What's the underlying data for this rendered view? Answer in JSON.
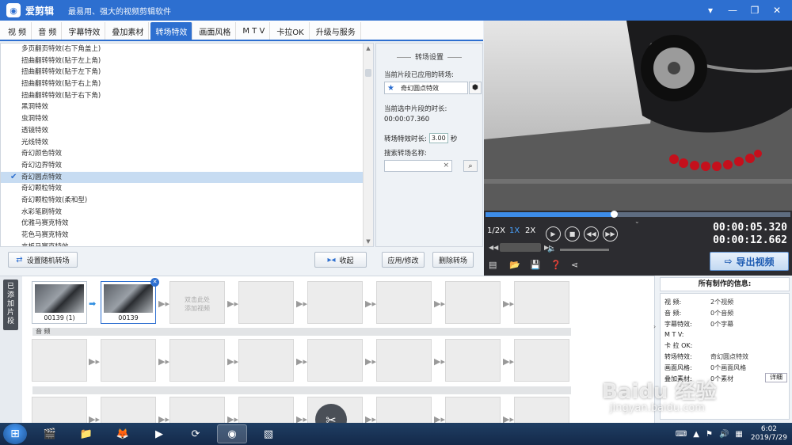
{
  "window": {
    "app_name": "爱剪辑",
    "slogan": "最易用、强大的视频剪辑软件",
    "logo_glyph": "◉",
    "controls": [
      "▾",
      "—",
      "❐",
      "✕"
    ]
  },
  "tabs": [
    {
      "label": "视 频",
      "active": false
    },
    {
      "label": "音 频",
      "active": false
    },
    {
      "label": "字幕特效",
      "active": false
    },
    {
      "label": "叠加素材",
      "active": false
    },
    {
      "label": "转场特效",
      "active": true
    },
    {
      "label": "画面风格",
      "active": false
    },
    {
      "label": "M T V",
      "active": false
    },
    {
      "label": "卡拉OK",
      "active": false
    },
    {
      "label": "升级与服务",
      "active": false
    }
  ],
  "effect_list": {
    "items": [
      "多页翻页特效(右下角盖上)",
      "扭曲翻转特效(贴于左上角)",
      "扭曲翻转特效(贴于左下角)",
      "扭曲翻转特效(贴于右上角)",
      "扭曲翻转特效(贴于右下角)",
      "黑洞特效",
      "虫洞特效",
      "透镜特效",
      "光线特效",
      "奇幻颜色特效",
      "奇幻边界特效",
      "奇幻圆点特效",
      "奇幻颗粒特效",
      "奇幻颗粒特效(柔和型)",
      "水彩笔刷特效",
      "优雅马赛克特效",
      "花色马赛克特效",
      "夹板马赛克特效"
    ],
    "selected_index": 11,
    "check_glyph": "✔",
    "scroll_up": "▲",
    "scroll_down": "▼"
  },
  "settings": {
    "title": "转场设置",
    "applied_label": "当前片段已应用的转场:",
    "applied_value": "奇幻圆点特效",
    "selected_duration_label": "当前选中片段的时长:",
    "selected_duration_value": "00:00:07.360",
    "transition_duration_label": "转场特效时长:",
    "transition_duration_value": "3.00",
    "seconds_unit": "秒",
    "search_label": "搜索转场名称:",
    "search_value": "",
    "search_clear": "×"
  },
  "actions": {
    "random_transition": "设置随机转场",
    "collapse": "收起",
    "apply_modify": "应用/修改",
    "delete_transition": "删除转场"
  },
  "player": {
    "speed_half": "1/2X",
    "speed_1x": "1X",
    "speed_2x": "2X",
    "current_time": "00:00:05.320",
    "total_time": "00:00:12.662",
    "progress_fraction": 0.42,
    "export_label": "导出视频"
  },
  "timeline": {
    "side_label": "已添加片段",
    "clips": [
      {
        "name": "00139 (1)",
        "selected": false
      },
      {
        "name": "00139",
        "selected": true
      }
    ],
    "add_hint": "双击此处\n添加视频",
    "audio_label": "音 频",
    "slot_count": 8
  },
  "info_panel": {
    "title": "所有制作的信息:",
    "rows": [
      {
        "k": "视    频:",
        "v": "2个视频"
      },
      {
        "k": "音    频:",
        "v": "0个音频"
      },
      {
        "k": "字幕特效:",
        "v": "0个字幕"
      },
      {
        "k": "M  T  V:",
        "v": ""
      },
      {
        "k": "卡 拉 OK:",
        "v": ""
      },
      {
        "k": "转场特效:",
        "v": "奇幻圆点特效"
      },
      {
        "k": "画面风格:",
        "v": "0个画面风格"
      },
      {
        "k": "叠加素材:",
        "v": "0个素材"
      }
    ],
    "detail_label": "详细"
  },
  "taskbar": {
    "apps": [
      "🎬",
      "📁",
      "🦊",
      "▶",
      "⟳",
      "◉",
      "▧"
    ],
    "active_index": 5,
    "clock_time": "6:02",
    "clock_date": "2019/7/29"
  },
  "watermark": {
    "brand": "Baidu 经验",
    "url": "jingyan.baidu.com"
  },
  "colors": {
    "accent": "#2d6fd0",
    "titlebar": "#2d6fd0",
    "player_bg": "#2c2c30"
  }
}
